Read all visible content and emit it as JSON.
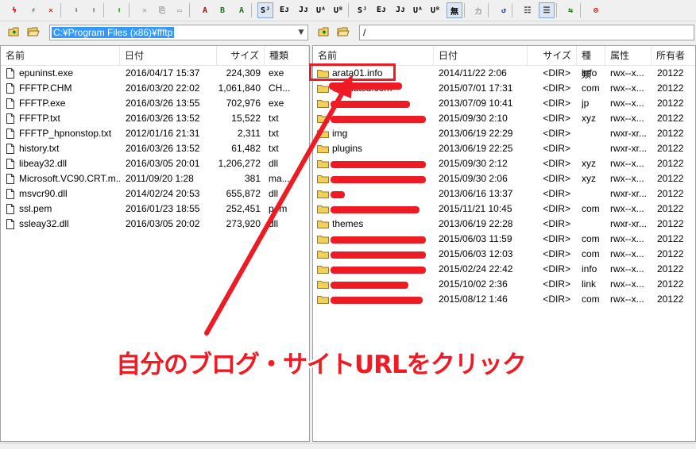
{
  "toolbar": {
    "items": [
      {
        "name": "connect-icon",
        "glyph": "ϟ",
        "color": "#cc0000",
        "pressed": false
      },
      {
        "name": "quick-connect-icon",
        "glyph": "⚡",
        "color": "#222222",
        "pressed": false
      },
      {
        "name": "disconnect-icon",
        "glyph": "✕",
        "color": "#aa0000",
        "pressed": false
      },
      {
        "name": "download-icon",
        "glyph": "⬇",
        "color": "#7a7a7a",
        "pressed": false
      },
      {
        "name": "upload-icon",
        "glyph": "⬆",
        "color": "#7a7a7a",
        "pressed": false
      },
      {
        "name": "mirror-upload-icon",
        "glyph": "⬆",
        "color": "#1a9a1a",
        "pressed": false
      },
      {
        "name": "delete-icon",
        "glyph": "✕",
        "color": "#9a9a9a",
        "pressed": false
      },
      {
        "name": "rename-icon",
        "glyph": "⎘",
        "color": "#9a9a9a",
        "pressed": false
      },
      {
        "name": "mkdir-icon",
        "glyph": "▭",
        "color": "#9a9a9a",
        "pressed": false
      },
      {
        "name": "ascii-mode-icon",
        "glyph": "A",
        "color": "#cc0000",
        "pressed": false
      },
      {
        "name": "binary-mode-icon",
        "glyph": "B",
        "color": "#1a7a1a",
        "pressed": false
      },
      {
        "name": "auto-mode-icon",
        "glyph": "A",
        "color": "#1a7a1a",
        "pressed": false
      },
      {
        "name": "kanji-sjis-host-icon",
        "glyph": "Sᴶ",
        "color": "#000000",
        "pressed": true
      },
      {
        "name": "kanji-euc-host-icon",
        "glyph": "Eᴊ",
        "color": "#000000",
        "pressed": false
      },
      {
        "name": "kanji-jis-host-icon",
        "glyph": "Jᴊ",
        "color": "#000000",
        "pressed": false
      },
      {
        "name": "kanji-utf8-host-icon",
        "glyph": "Uᴬ",
        "color": "#000000",
        "pressed": false
      },
      {
        "name": "kanji-utf8bom-host-icon",
        "glyph": "Uᴮ",
        "color": "#000000",
        "pressed": false
      },
      {
        "name": "kanji-sjis-local-icon",
        "glyph": "Sᴶ",
        "color": "#000000",
        "pressed": false
      },
      {
        "name": "kanji-euc-local-icon",
        "glyph": "Eᴊ",
        "color": "#000000",
        "pressed": false
      },
      {
        "name": "kanji-jis-local-icon",
        "glyph": "Jᴊ",
        "color": "#000000",
        "pressed": false
      },
      {
        "name": "kanji-utf8-local-icon",
        "glyph": "Uᴬ",
        "color": "#000000",
        "pressed": false
      },
      {
        "name": "kanji-utf8bom-local-icon",
        "glyph": "Uᴮ",
        "color": "#000000",
        "pressed": false
      },
      {
        "name": "no-conversion-icon",
        "glyph": "無",
        "color": "#000000",
        "pressed": true
      },
      {
        "name": "kana-conversion-icon",
        "glyph": "カ",
        "color": "#9a9a9a",
        "pressed": false
      },
      {
        "name": "refresh-icon",
        "glyph": "↺",
        "color": "#1a3fa0",
        "pressed": false
      },
      {
        "name": "list-view-icon",
        "glyph": "☷",
        "color": "#333333",
        "pressed": false
      },
      {
        "name": "detail-view-icon",
        "glyph": "☰",
        "color": "#333333",
        "pressed": true
      },
      {
        "name": "sync-folders-icon",
        "glyph": "⇆",
        "color": "#1a7a1a",
        "pressed": false
      },
      {
        "name": "abort-icon",
        "glyph": "⊘",
        "color": "#cc0000",
        "pressed": false
      }
    ]
  },
  "local": {
    "path": "C:¥Program Files (x86)¥ffftp",
    "columns": {
      "name": "名前",
      "date": "日付",
      "size": "サイズ",
      "type": "種類"
    },
    "files": [
      {
        "name": "epuninst.exe",
        "date": "2016/04/17 15:37",
        "size": "224,309",
        "type": "exe"
      },
      {
        "name": "FFFTP.CHM",
        "date": "2016/03/20 22:02",
        "size": "1,061,840",
        "type": "CH..."
      },
      {
        "name": "FFFTP.exe",
        "date": "2016/03/26 13:55",
        "size": "702,976",
        "type": "exe"
      },
      {
        "name": "FFFTP.txt",
        "date": "2016/03/26 13:52",
        "size": "15,522",
        "type": "txt"
      },
      {
        "name": "FFFTP_hpnonstop.txt",
        "date": "2012/01/16 21:31",
        "size": "2,311",
        "type": "txt"
      },
      {
        "name": "history.txt",
        "date": "2016/03/26 13:52",
        "size": "61,482",
        "type": "txt"
      },
      {
        "name": "libeay32.dll",
        "date": "2016/03/05 20:01",
        "size": "1,206,272",
        "type": "dll"
      },
      {
        "name": "Microsoft.VC90.CRT.m...",
        "date": "2011/09/20  1:28",
        "size": "381",
        "type": "ma..."
      },
      {
        "name": "msvcr90.dll",
        "date": "2014/02/24 20:53",
        "size": "655,872",
        "type": "dll"
      },
      {
        "name": "ssl.pem",
        "date": "2016/01/23 18:55",
        "size": "252,451",
        "type": "pem"
      },
      {
        "name": "ssleay32.dll",
        "date": "2016/03/05 20:02",
        "size": "273,920",
        "type": "dll"
      }
    ]
  },
  "remote": {
    "path": "/",
    "columns": {
      "name": "名前",
      "date": "日付",
      "size": "サイズ",
      "type": "種類",
      "attr": "属性",
      "owner": "所有者"
    },
    "files": [
      {
        "name": "arata01.info",
        "redacted": false,
        "date": "2014/11/22  2:06",
        "size": "<DIR>",
        "type": "info",
        "attr": "rwx--x...",
        "owner": "20122"
      },
      {
        "name": "oy-matsu.com",
        "redacted": true,
        "date": "2015/07/01 17:31",
        "size": "<DIR>",
        "type": "com",
        "attr": "rwx--x...",
        "owner": "20122"
      },
      {
        "name": "",
        "redacted": true,
        "date": "2013/07/09 10:41",
        "size": "<DIR>",
        "type": "jp",
        "attr": "rwx--x...",
        "owner": "20122"
      },
      {
        "name": "",
        "redacted": true,
        "date": "2015/09/30  2:10",
        "size": "<DIR>",
        "type": "xyz",
        "attr": "rwx--x...",
        "owner": "20122"
      },
      {
        "name": "img",
        "redacted": false,
        "date": "2013/06/19 22:29",
        "size": "<DIR>",
        "type": "",
        "attr": "rwxr-xr...",
        "owner": "20122"
      },
      {
        "name": "plugins",
        "redacted": false,
        "date": "2013/06/19 22:25",
        "size": "<DIR>",
        "type": "",
        "attr": "rwxr-xr...",
        "owner": "20122"
      },
      {
        "name": "",
        "redacted": true,
        "date": "2015/09/30  2:12",
        "size": "<DIR>",
        "type": "xyz",
        "attr": "rwx--x...",
        "owner": "20122"
      },
      {
        "name": "",
        "redacted": true,
        "date": "2015/09/30  2:06",
        "size": "<DIR>",
        "type": "xyz",
        "attr": "rwx--x...",
        "owner": "20122"
      },
      {
        "name": "",
        "redacted": true,
        "date": "2013/06/16 13:37",
        "size": "<DIR>",
        "type": "",
        "attr": "rwxr-xr...",
        "owner": "20122"
      },
      {
        "name": "",
        "redacted": true,
        "date": "2015/11/21 10:45",
        "size": "<DIR>",
        "type": "com",
        "attr": "rwx--x...",
        "owner": "20122"
      },
      {
        "name": "themes",
        "redacted": false,
        "date": "2013/06/19 22:28",
        "size": "<DIR>",
        "type": "",
        "attr": "rwxr-xr...",
        "owner": "20122"
      },
      {
        "name": "",
        "redacted": true,
        "date": "2015/06/03 11:59",
        "size": "<DIR>",
        "type": "com",
        "attr": "rwx--x...",
        "owner": "20122"
      },
      {
        "name": "",
        "redacted": true,
        "date": "2015/06/03 12:03",
        "size": "<DIR>",
        "type": "com",
        "attr": "rwx--x...",
        "owner": "20122"
      },
      {
        "name": "",
        "redacted": true,
        "date": "2015/02/24 22:42",
        "size": "<DIR>",
        "type": "info",
        "attr": "rwx--x...",
        "owner": "20122"
      },
      {
        "name": "",
        "redacted": true,
        "date": "2015/10/02  2:36",
        "size": "<DIR>",
        "type": "link",
        "attr": "rwx--x...",
        "owner": "20122"
      },
      {
        "name": "",
        "redacted": true,
        "date": "2015/08/12  1:46",
        "size": "<DIR>",
        "type": "com",
        "attr": "rwx--x...",
        "owner": "20122"
      }
    ]
  },
  "annotation": {
    "callout": "自分のブログ・サイトURLをクリック",
    "color": "#ee1b24"
  }
}
